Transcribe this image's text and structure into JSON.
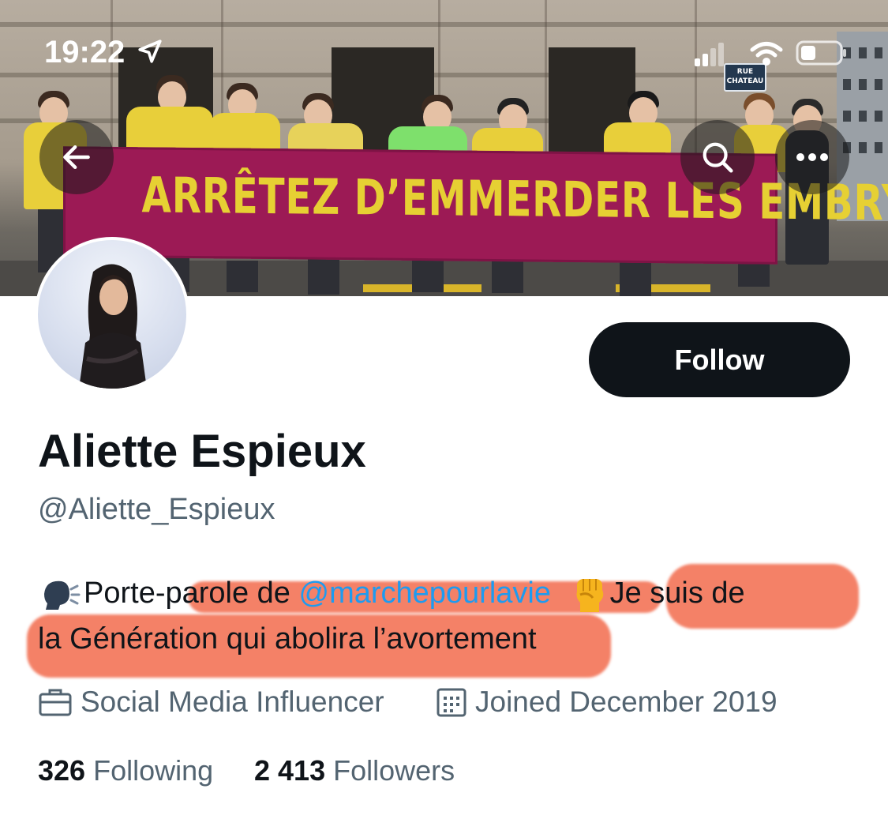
{
  "status_bar": {
    "time": "19:22",
    "icons": [
      "location-arrow-icon",
      "cellular-signal-icon",
      "wifi-icon",
      "battery-icon"
    ]
  },
  "header_banner": {
    "banner_text": "ARRÊTEZ D’EMMERDER LES EMBRYONS",
    "street_sign": [
      "RUE",
      "CHATEAU"
    ],
    "banner_color": "#9c1a55",
    "banner_text_color": "#e6d033"
  },
  "nav": {
    "back_icon": "arrow-left-icon",
    "search_icon": "search-icon",
    "more_icon": "more-horizontal-icon"
  },
  "profile": {
    "follow_label": "Follow",
    "display_name": "Aliette Espieux",
    "handle": "@Aliette_Espieux",
    "bio": {
      "line1_pre": "Porte-parole de ",
      "mention": "@marchepourlavie",
      "line1_post": "Je suis de",
      "line2": "la Génération qui abolira l’avortement",
      "emojis": [
        "speaking-head-emoji",
        "raised-fist-emoji"
      ]
    },
    "occupation": "Social Media Influencer",
    "joined": "Joined December 2019",
    "following_count": "326",
    "following_label": "Following",
    "followers_count": "2 413",
    "followers_label": "Followers"
  },
  "colors": {
    "accent": "#1d9bf0",
    "secondary_text": "#536471",
    "primary_text": "#0f1419",
    "highlight_marker": "#f0502d"
  }
}
